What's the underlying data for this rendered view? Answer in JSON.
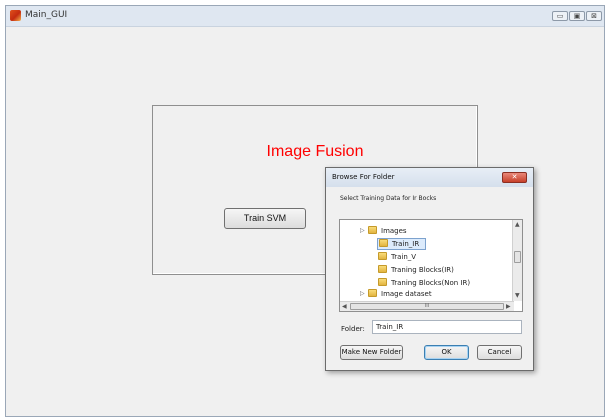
{
  "window": {
    "title": "Main_GUI",
    "controls": {
      "minimize": "▭",
      "maximize": "▣",
      "close": "⊠"
    }
  },
  "panel": {
    "title": "Image Fusion",
    "train_button": "Train SVM",
    "title_color": "#ff0000"
  },
  "dialog": {
    "title": "Browse For Folder",
    "close_glyph": "✕",
    "instruction": "Select Training Data for Ir Bocks",
    "tree_items": [
      {
        "label": "Images",
        "expandable": true,
        "selected": false
      },
      {
        "label": "Train_IR",
        "expandable": false,
        "selected": true
      },
      {
        "label": "Train_V",
        "expandable": false,
        "selected": false
      },
      {
        "label": "Traning Blocks(IR)",
        "expandable": false,
        "selected": false
      },
      {
        "label": "Traning Blocks(Non IR)",
        "expandable": false,
        "selected": false
      },
      {
        "label": "Image dataset",
        "expandable": true,
        "selected": false
      }
    ],
    "hscroll_grip": "III",
    "folder_label": "Folder:",
    "folder_value": "Train_IR",
    "buttons": {
      "make_new_folder": "Make New Folder",
      "ok": "OK",
      "cancel": "Cancel"
    }
  }
}
